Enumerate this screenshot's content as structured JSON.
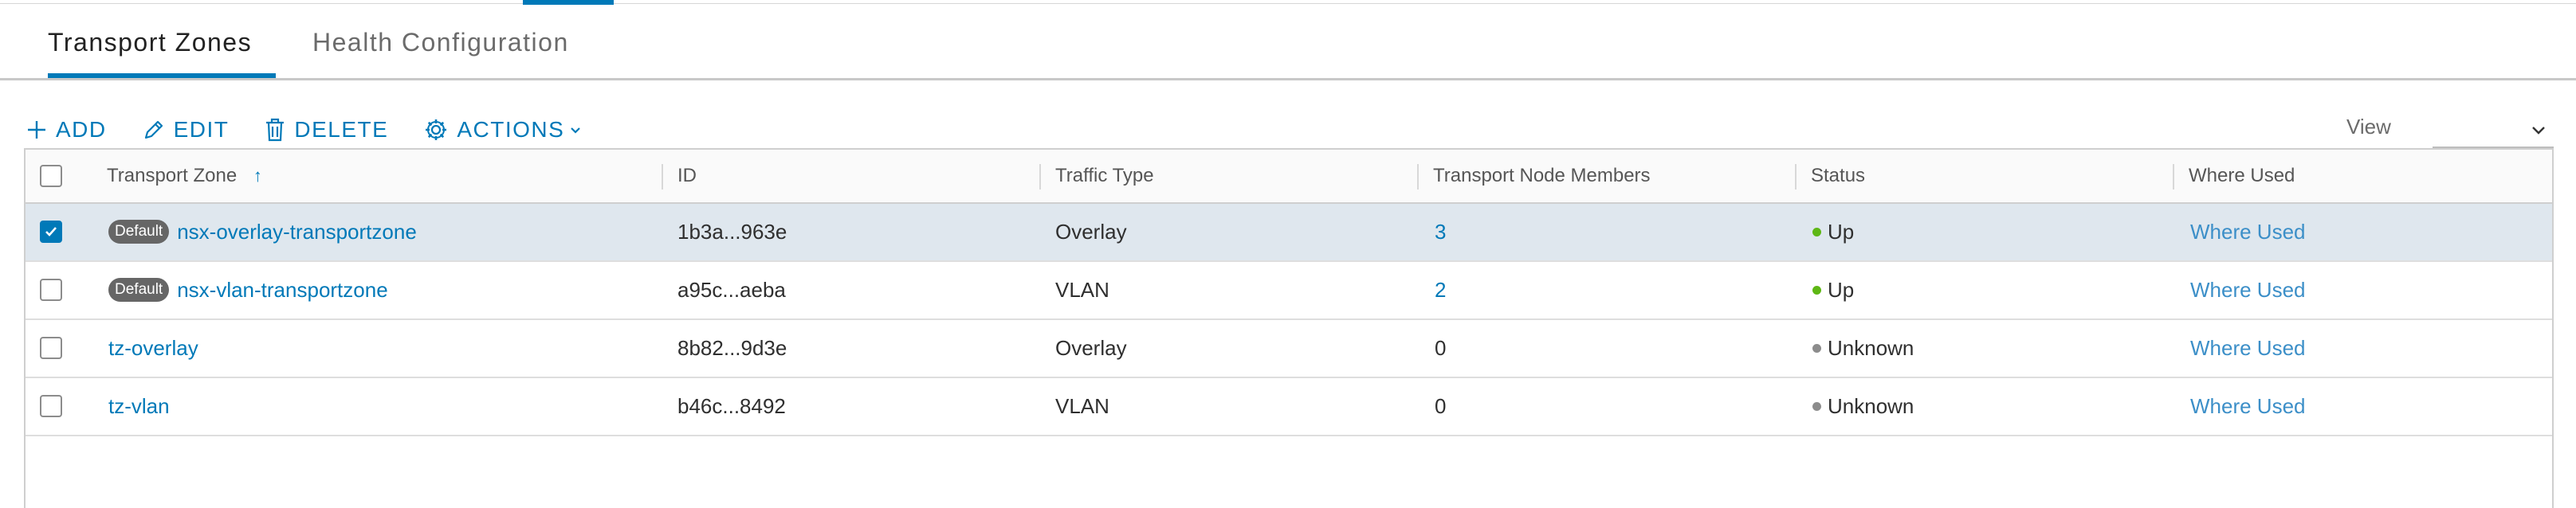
{
  "tabs": {
    "active": "Transport Zones",
    "inactive": "Health Configuration"
  },
  "toolbar": {
    "add": "ADD",
    "edit": "EDIT",
    "delete": "DELETE",
    "actions": "ACTIONS"
  },
  "view": {
    "label": "View",
    "value": ""
  },
  "table": {
    "columns": [
      "Transport Zone",
      "ID",
      "Traffic Type",
      "Transport Node Members",
      "Status",
      "Where Used"
    ],
    "sort_indicator": "↑",
    "rows": [
      {
        "selected": true,
        "badge": "Default",
        "name": "nsx-overlay-transportzone",
        "id": "1b3a...963e",
        "traffic": "Overlay",
        "members": "3",
        "status": "Up",
        "where_used": "Where Used"
      },
      {
        "selected": false,
        "badge": "Default",
        "name": "nsx-vlan-transportzone",
        "id": "a95c...aeba",
        "traffic": "VLAN",
        "members": "2",
        "status": "Up",
        "where_used": "Where Used"
      },
      {
        "selected": false,
        "badge": "",
        "name": "tz-overlay",
        "id": "8b82...9d3e",
        "traffic": "Overlay",
        "members": "0",
        "status": "Unknown",
        "where_used": "Where Used"
      },
      {
        "selected": false,
        "badge": "",
        "name": "tz-vlan",
        "id": "b46c...8492",
        "traffic": "VLAN",
        "members": "0",
        "status": "Unknown",
        "where_used": "Where Used"
      }
    ]
  },
  "colors": {
    "accent": "#0079b8",
    "status_up": "#5eb715",
    "status_unknown": "#8c8c8c",
    "selected_row": "#dfe7ee"
  }
}
